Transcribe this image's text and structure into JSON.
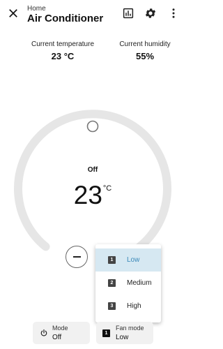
{
  "header": {
    "breadcrumb": "Home",
    "title": "Air Conditioner",
    "icons": [
      "close-icon",
      "history-chart-icon",
      "gear-icon",
      "more-vert-icon"
    ]
  },
  "stats": {
    "temperature_label": "Current temperature",
    "temperature_value": "23 °C",
    "humidity_label": "Current humidity",
    "humidity_value": "55%"
  },
  "dial": {
    "state": "Off",
    "target_temp": "23",
    "unit": "°C"
  },
  "fan_menu": {
    "items": [
      {
        "icon_text": "1",
        "label": "Low",
        "selected": true
      },
      {
        "icon_text": "2",
        "label": "Medium",
        "selected": false
      },
      {
        "icon_text": "3",
        "label": "High",
        "selected": false
      }
    ]
  },
  "bottom": {
    "mode_label": "Mode",
    "mode_value": "Off",
    "fan_label": "Fan mode",
    "fan_value": "Low",
    "fan_icon_text": "1"
  },
  "colors": {
    "accent": "#3a88b8",
    "selected_bg": "#d6e8f2",
    "dial_track": "#e6e6e6",
    "chip_bg": "#f1f1f1"
  }
}
